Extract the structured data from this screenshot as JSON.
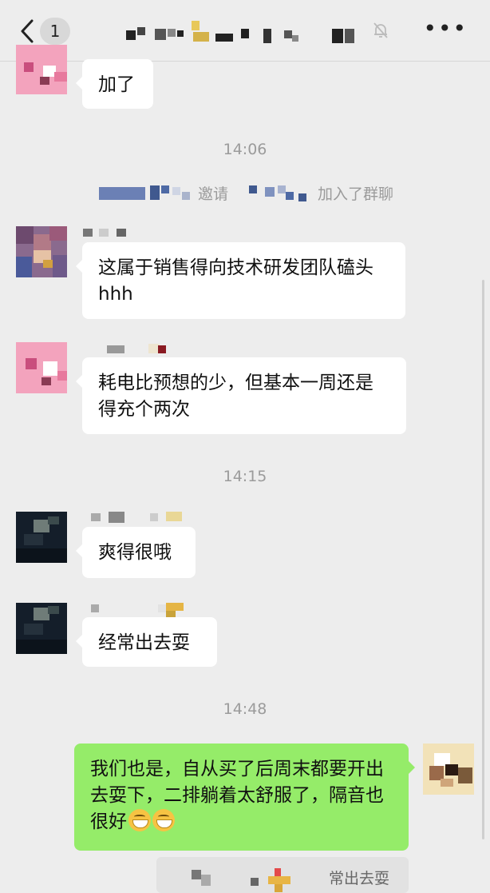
{
  "header": {
    "back_label": "1",
    "menu_glyph": "•••"
  },
  "icons": {
    "back": "chevron-left-icon",
    "mute": "bell-muted-icon",
    "more": "more-dots-icon"
  },
  "messages": {
    "m0": "加了",
    "t1": "14:06",
    "sys1_a": "邀请",
    "sys1_b": "加入了群聊",
    "m1": "这属于销售得向技术研发团队磕头hhh",
    "m2": "耗电比预想的少，但基本一周还是得充个两次",
    "t2": "14:15",
    "m3": "爽得很哦",
    "m4": "经常出去耍",
    "t3": "14:48",
    "m5": "我们也是，自从买了后周末都要开出去耍下，二排躺着太舒服了，隔音也很好",
    "quote": "常出去耍"
  },
  "colors": {
    "background": "#ededed",
    "bubble_self": "#95ec69",
    "bubble_other": "#ffffff",
    "time_text": "#9b9b9b"
  }
}
